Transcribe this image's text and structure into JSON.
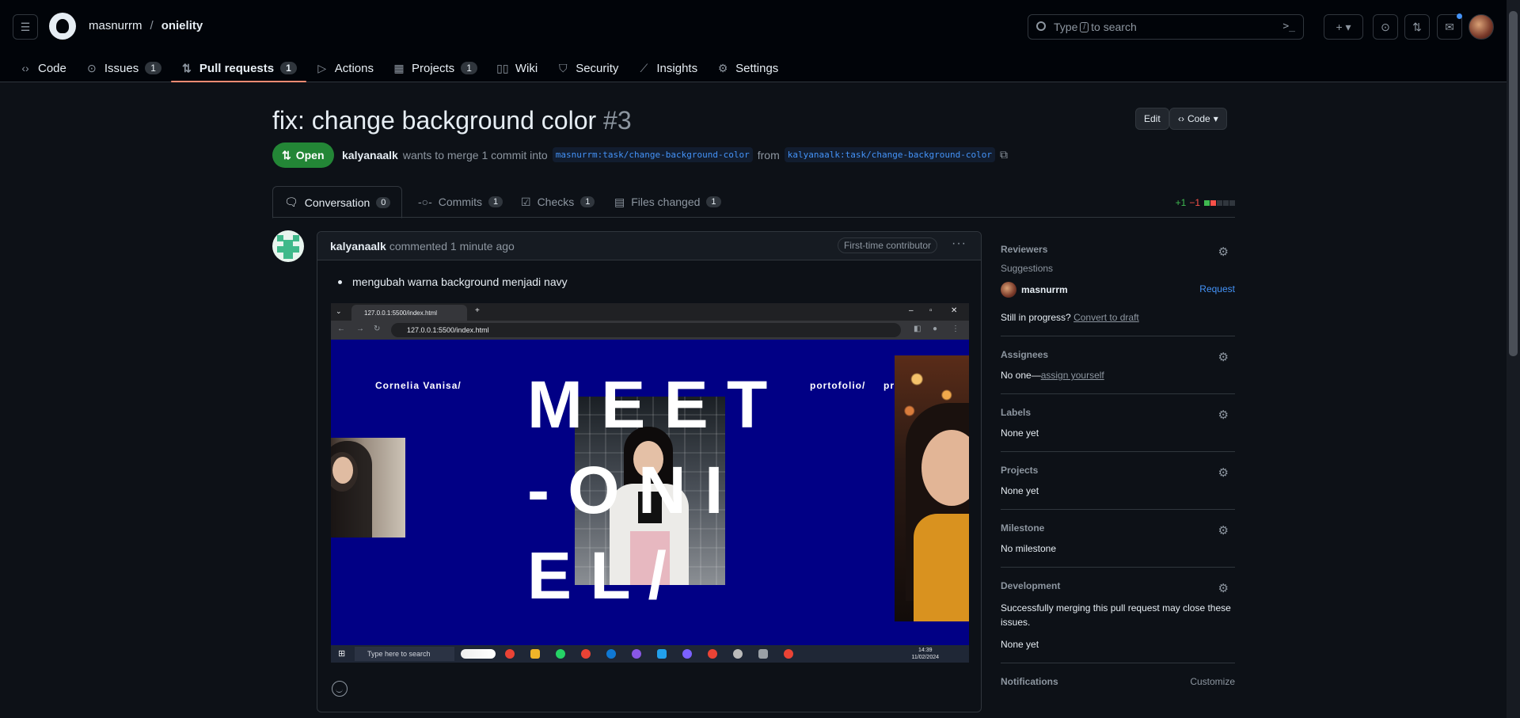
{
  "header": {
    "owner": "masnurrm",
    "separator": "/",
    "repo": "onielity",
    "search_placeholder_pre": "Type",
    "search_key": "/",
    "search_placeholder_post": "to search",
    "nav": [
      {
        "label": "Code",
        "icon": "code-icon",
        "glyph": "‹›"
      },
      {
        "label": "Issues",
        "icon": "issue-icon",
        "glyph": "⊙",
        "count": "1"
      },
      {
        "label": "Pull requests",
        "icon": "pull-request-icon",
        "glyph": "⇅",
        "count": "1",
        "active": true
      },
      {
        "label": "Actions",
        "icon": "play-icon",
        "glyph": "▷"
      },
      {
        "label": "Projects",
        "icon": "table-icon",
        "glyph": "▦",
        "count": "1"
      },
      {
        "label": "Wiki",
        "icon": "book-icon",
        "glyph": "▯▯"
      },
      {
        "label": "Security",
        "icon": "shield-icon",
        "glyph": "⛉"
      },
      {
        "label": "Insights",
        "icon": "graph-icon",
        "glyph": "⟋"
      },
      {
        "label": "Settings",
        "icon": "gear-icon",
        "glyph": "⚙"
      }
    ]
  },
  "pr": {
    "title": "fix: change background color",
    "number": "#3",
    "edit_label": "Edit",
    "code_label": "Code",
    "state": "Open",
    "author": "kalyanaalk",
    "merge_text": "wants to merge 1 commit into",
    "base_branch": "masnurrm:task/change-background-color",
    "from_text": "from",
    "head_branch": "kalyanaalk:task/change-background-color"
  },
  "tabs": [
    {
      "label": "Conversation",
      "count": "0",
      "icon": "comment-icon",
      "glyph": "▭"
    },
    {
      "label": "Commits",
      "count": "1",
      "icon": "commit-icon",
      "glyph": "-○-"
    },
    {
      "label": "Checks",
      "count": "1",
      "icon": "checklist-icon",
      "glyph": "☑"
    },
    {
      "label": "Files changed",
      "count": "1",
      "icon": "file-diff-icon",
      "glyph": "▤"
    }
  ],
  "diffstat": {
    "additions": "+1",
    "deletions": "−1",
    "colors": {
      "add": "#3fb950",
      "del": "#f85149",
      "neutral": "#30363d"
    }
  },
  "comment": {
    "author": "kalyanaalk",
    "action": "commented",
    "time": "1 minute ago",
    "badge": "First-time contributor",
    "body_item": "mengubah warna background menjadi navy",
    "screenshot": {
      "tab_title": "127.0.0.1:5500/index.html",
      "url": "127.0.0.1:5500/index.html",
      "label_left": "Cornelia Vanisa/",
      "label_mid": "portofolio/",
      "label_right": "profile/",
      "big_line1": "M E E T",
      "big_line2": "- O N I",
      "big_line3": "E L /",
      "taskbar_search": "Type here to search",
      "clock_time": "14:39",
      "clock_date": "11/02/2024",
      "page_bg": "#010085"
    }
  },
  "sidebar": {
    "reviewers": {
      "title": "Reviewers",
      "suggestions": "Suggestions",
      "user": "masnurrm",
      "request": "Request",
      "progress_q": "Still in progress?",
      "convert": "Convert to draft"
    },
    "assignees": {
      "title": "Assignees",
      "value_pre": "No one—",
      "assign": "assign yourself"
    },
    "labels": {
      "title": "Labels",
      "value": "None yet"
    },
    "projects": {
      "title": "Projects",
      "value": "None yet"
    },
    "milestone": {
      "title": "Milestone",
      "value": "No milestone"
    },
    "development": {
      "title": "Development",
      "desc": "Successfully merging this pull request may close these issues.",
      "value": "None yet"
    },
    "notifications": {
      "title": "Notifications",
      "customize": "Customize"
    }
  }
}
